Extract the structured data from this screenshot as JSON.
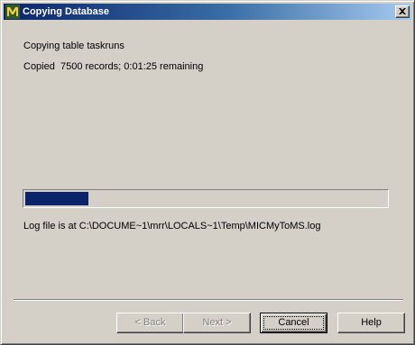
{
  "window": {
    "title": "Copying Database",
    "app_icon": "mysql-migration-icon",
    "close_icon": "close-icon"
  },
  "status": {
    "current_table": "Copying table taskruns",
    "progress_text": "Copied  7500 records; 0:01:25 remaining"
  },
  "progress": {
    "fraction": 0.175,
    "fill_color": "#0a246a"
  },
  "log": {
    "text": "Log file is at C:\\DOCUME~1\\mrr\\LOCALS~1\\Temp\\MICMyToMS.log"
  },
  "buttons": {
    "back_label": "< Back",
    "next_label": "Next >",
    "cancel_label": "Cancel",
    "help_label": "Help"
  }
}
